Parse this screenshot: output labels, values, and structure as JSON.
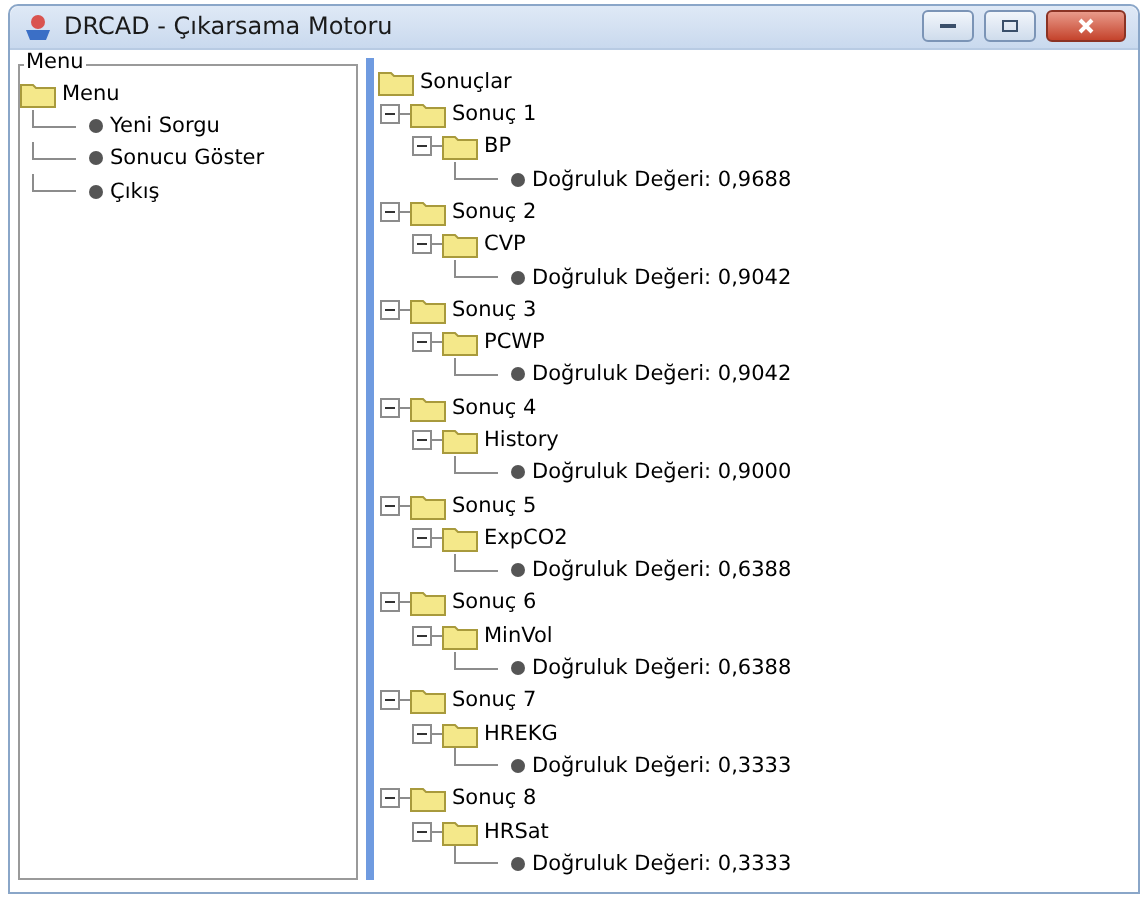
{
  "window": {
    "title": "DRCAD - Çıkarsama Motoru"
  },
  "menu_panel": {
    "title": "Menu",
    "tree": [
      {
        "label": "Menu",
        "children": [
          {
            "label": "Yeni Sorgu"
          },
          {
            "label": "Sonucu Göster"
          },
          {
            "label": "Çıkış"
          }
        ]
      }
    ]
  },
  "results_tree": [
    {
      "label": "Sonuçlar",
      "children": [
        {
          "label": "Sonuç 1",
          "expanded": true,
          "children": [
            {
              "label": "BP",
              "expanded": true,
              "children": [
                {
                  "label": "Doğruluk Değeri: 0,9688"
                }
              ]
            }
          ]
        },
        {
          "label": "Sonuç 2",
          "expanded": true,
          "children": [
            {
              "label": "CVP",
              "expanded": true,
              "children": [
                {
                  "label": "Doğruluk Değeri: 0,9042"
                }
              ]
            }
          ]
        },
        {
          "label": "Sonuç 3",
          "expanded": true,
          "children": [
            {
              "label": "PCWP",
              "expanded": true,
              "children": [
                {
                  "label": "Doğruluk Değeri: 0,9042"
                }
              ]
            }
          ]
        },
        {
          "label": "Sonuç 4",
          "expanded": true,
          "children": [
            {
              "label": "History",
              "expanded": true,
              "children": [
                {
                  "label": "Doğruluk Değeri: 0,9000"
                }
              ]
            }
          ]
        },
        {
          "label": "Sonuç 5",
          "expanded": true,
          "children": [
            {
              "label": "ExpCO2",
              "expanded": true,
              "children": [
                {
                  "label": "Doğruluk Değeri: 0,6388"
                }
              ]
            }
          ]
        },
        {
          "label": "Sonuç 6",
          "expanded": true,
          "children": [
            {
              "label": "MinVol",
              "expanded": true,
              "children": [
                {
                  "label": "Doğruluk Değeri: 0,6388"
                }
              ]
            }
          ]
        },
        {
          "label": "Sonuç 7",
          "expanded": true,
          "children": [
            {
              "label": "HREKG",
              "expanded": true,
              "children": [
                {
                  "label": "Doğruluk Değeri: 0,3333"
                }
              ]
            }
          ]
        },
        {
          "label": "Sonuç 8",
          "expanded": true,
          "children": [
            {
              "label": "HRSat",
              "expanded": true,
              "children": [
                {
                  "label": "Doğruluk Değeri: 0,3333"
                }
              ]
            }
          ]
        }
      ]
    }
  ]
}
